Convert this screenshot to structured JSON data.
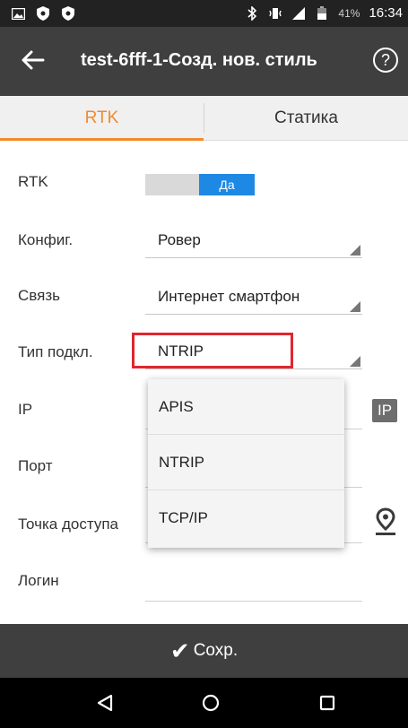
{
  "status_bar": {
    "battery_percent": "41%",
    "time": "16:34",
    "left_icons": [
      "image-icon",
      "shield-icon",
      "shield-icon"
    ],
    "right_icons": [
      "bluetooth-icon",
      "vibrate-icon",
      "signal-icon",
      "battery-icon"
    ]
  },
  "app_bar": {
    "title": "test-6fff-1-Созд. нов. стиль",
    "back_icon": "arrow-left-icon",
    "help_icon": "help-circle-icon"
  },
  "tabs": [
    {
      "label": "RTK",
      "active": true
    },
    {
      "label": "Статика",
      "active": false
    }
  ],
  "form": {
    "rtk": {
      "label": "RTK",
      "toggle_value": "Да"
    },
    "config": {
      "label": "Конфиг.",
      "value": "Ровер"
    },
    "link": {
      "label": "Связь",
      "value": "Интернет смартфон"
    },
    "conn_type": {
      "label": "Тип подкл.",
      "value": "NTRIP"
    },
    "ip": {
      "label": "IP",
      "badge": "IP"
    },
    "port": {
      "label": "Порт"
    },
    "access_point": {
      "label": "Точка доступа"
    },
    "login": {
      "label": "Логин"
    }
  },
  "dropdown": {
    "options": [
      "APIS",
      "NTRIP",
      "TCP/IP"
    ]
  },
  "save_bar": {
    "label": "Сохр."
  },
  "colors": {
    "accent": "#f28a2c",
    "appbar": "#3f3f3f",
    "toggle_on": "#1e88e5",
    "highlight": "#e0262e"
  }
}
